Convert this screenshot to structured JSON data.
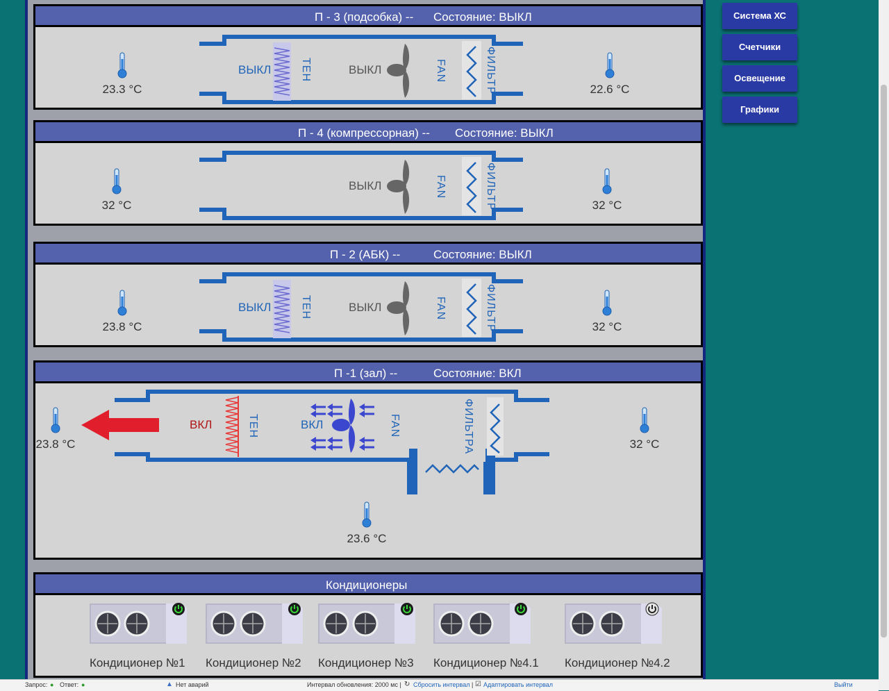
{
  "panels": [
    {
      "title": "П - 3 (подсобка) --",
      "state": "Состояние: ВЫКЛ",
      "temp_in": "23.3 °C",
      "temp_out": "22.6 °C",
      "heater_state": "ВЫКЛ",
      "heater_label": "ТЕН",
      "fan_state": "ВЫКЛ",
      "fan_label": "FAN",
      "filter_label": "ФИЛЬТР"
    },
    {
      "title": "П - 4 (компрессорная) --",
      "state": "Состояние: ВЫКЛ",
      "temp_in": "32 °C",
      "temp_out": "32 °C",
      "fan_state": "ВЫКЛ",
      "fan_label": "FAN",
      "filter_label": "ФИЛЬТР"
    },
    {
      "title": "П - 2 (АБК) --",
      "state": "Состояние: ВЫКЛ",
      "temp_in": "23.8 °C",
      "temp_out": "32 °C",
      "heater_state": "ВЫКЛ",
      "heater_label": "ТЕН",
      "fan_state": "ВЫКЛ",
      "fan_label": "FAN",
      "filter_label": "ФИЛЬТР"
    },
    {
      "title": "П -1 (зал) --",
      "state": "Состояние: ВКЛ",
      "temp_in": "23.8 °C",
      "temp_out": "32 °C",
      "temp_bottom": "23.6 °C",
      "heater_state": "ВКЛ",
      "heater_label": "ТЕН",
      "fan_state": "ВКЛ",
      "fan_label": "FAN",
      "filter_label": "ФИЛЬТРА"
    }
  ],
  "conditioners": {
    "title": "Кондиционеры",
    "items": [
      {
        "label": "Кондиционер №1",
        "power": "on"
      },
      {
        "label": "Кондиционер №2",
        "power": "on"
      },
      {
        "label": "Кондиционер №3",
        "power": "on"
      },
      {
        "label": "Кондиционер №4.1",
        "power": "on"
      },
      {
        "label": "Кондиционер №4.2",
        "power": "off"
      }
    ]
  },
  "nav": {
    "items": [
      "Система ХС",
      "Счетчики",
      "Освещение",
      "Графики"
    ]
  },
  "status": {
    "request": "Запрос:",
    "response": "Ответ:",
    "dot": "●",
    "alarms": "Нет аварий",
    "interval": "Интервал обновления: 2000 мс |",
    "reset": "Сбросить интервал",
    "sep": "|",
    "adapt": "Адаптировать интервал",
    "logout": "Выйти"
  },
  "colors": {
    "header": "#5461ad",
    "duct": "#1f64b8",
    "nav": "#2a3aa4",
    "on": "#2a9a2a",
    "heater_on": "#e83838",
    "arrow": "#e01e2c"
  }
}
